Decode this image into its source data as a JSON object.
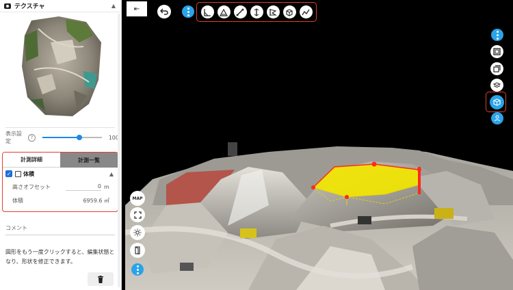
{
  "sidebar": {
    "texture_title": "テクスチャ",
    "display_label": "表示設定",
    "help_symbol": "?",
    "opacity_value": "100",
    "opacity_fraction": 0.62,
    "tabs": [
      "計測詳細",
      "計測一覧"
    ],
    "measurement": {
      "name": "体積",
      "offset_label": "高さオフセット",
      "offset_value": "0",
      "offset_unit": "m",
      "volume_label": "体積",
      "volume_value": "6959.6 ㎥"
    },
    "comment_label": "コメント",
    "hint": "図形をもう一度クリックすると、編集状態となり、形状を修正できます。"
  },
  "viewer": {
    "map_label": "MAP",
    "top_tools": [
      "angle-measure-icon",
      "area-measure-icon",
      "distance-measure-icon",
      "height-measure-icon",
      "polygon-flag-icon",
      "volume-measure-icon",
      "profile-line-icon"
    ],
    "right_tools": [
      "more-icon",
      "frame-icon",
      "layers-icon",
      "stack-icon",
      "cube-view-icon",
      "person-view-icon"
    ],
    "left_tools": [
      "map-icon",
      "fullscreen-icon",
      "sun-icon",
      "door-icon",
      "more-icon"
    ]
  },
  "colors": {
    "accent_blue": "#2aa3e8",
    "highlight_red": "#e0402c",
    "polygon_yellow": "#f2e600"
  }
}
